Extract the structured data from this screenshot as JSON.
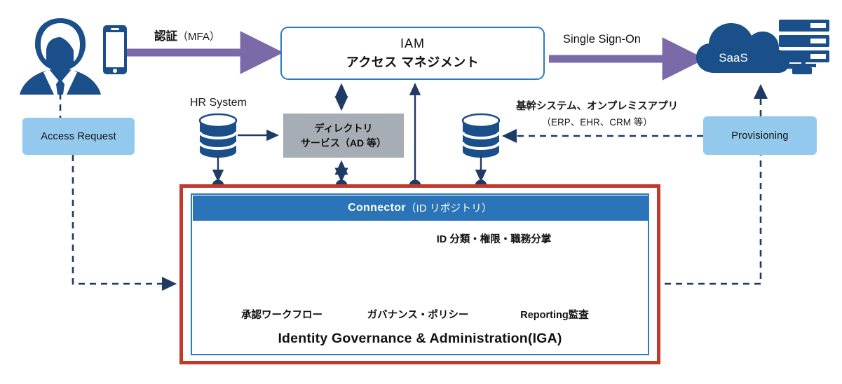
{
  "diagram": {
    "title": "IAM / IGA architecture diagram",
    "colors": {
      "dark_blue": "#1a4f8a",
      "mid_blue": "#2b74b8",
      "light_blue": "#92c9ec",
      "icon_blue": "#5b92d4",
      "gray": "#a6adb4",
      "red": "#c0392b",
      "purple": "#7a6aa8",
      "arrow_navy": "#1f3a63"
    }
  },
  "actors": {
    "user_icon": "person-with-smartphone-icon",
    "saas_label": "SaaS",
    "saas_icon": "cloud-icon",
    "server_icon": "server-rack-icon"
  },
  "flows": {
    "auth_label": "認証",
    "auth_paren": "（MFA）",
    "sso_label": "Single Sign-On",
    "hr_system_label": "HR System",
    "core_systems_label": "基幹システム、オンプレミスアプリ",
    "core_systems_sub": "（ERP、EHR、CRM 等）"
  },
  "boxes": {
    "access_request": "Access Request",
    "provisioning": "Provisioning",
    "iam_line1": "IAM",
    "iam_line2": "アクセス マネジメント",
    "directory_line1": "ディレクトリ",
    "directory_line2": "サービス（AD 等）"
  },
  "iga": {
    "connector_title": "Connector",
    "connector_paren": "（ID リポジトリ）",
    "id_classification": "ID 分類・権限・職務分掌",
    "footer_title": "Identity Governance & Administration(IGA)",
    "features": [
      {
        "icon": "workflow-path-icon",
        "label": "承認ワークフロー"
      },
      {
        "icon": "siren-alarm-icon",
        "label": "ガバナンス・ポリシー"
      },
      {
        "icon": "document-magnifier-icon",
        "label": "Reporting監査"
      }
    ]
  }
}
